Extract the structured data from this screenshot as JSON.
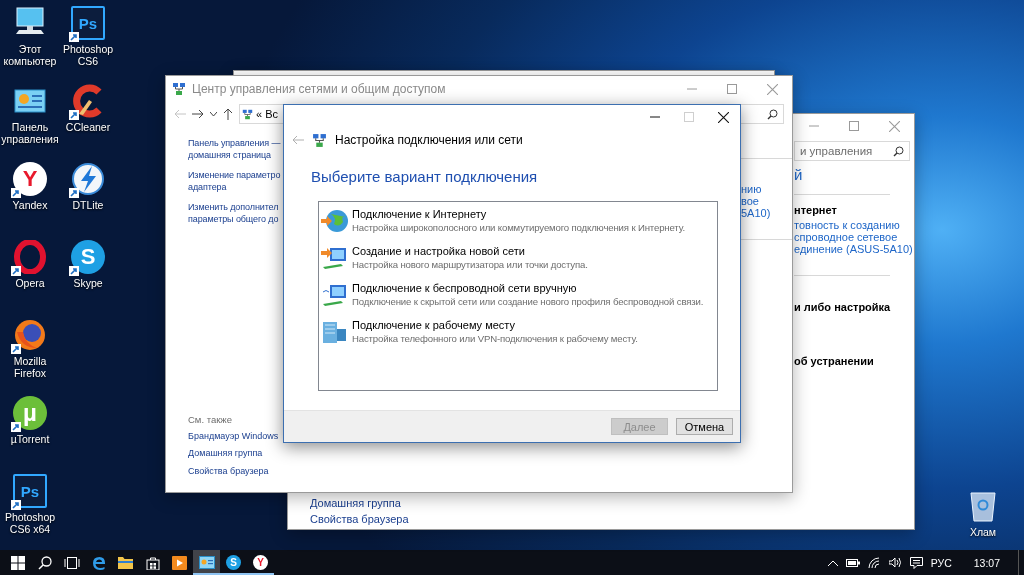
{
  "desktop_icons": [
    {
      "label": "Этот компьютер",
      "kind": "computer",
      "shortcut": false
    },
    {
      "label": "Панель управления",
      "kind": "control-panel",
      "shortcut": false
    },
    {
      "label": "Yandex",
      "kind": "yandex",
      "badge": "Y",
      "shortcut": true
    },
    {
      "label": "Opera",
      "kind": "opera",
      "shortcut": true
    },
    {
      "label": "Mozilla Firefox",
      "kind": "firefox",
      "shortcut": true
    },
    {
      "label": "µTorrent",
      "kind": "utorrent",
      "badge": "µ",
      "shortcut": true
    },
    {
      "label": "Photoshop CS6 x64",
      "kind": "photoshop",
      "badge": "Ps",
      "shortcut": true
    },
    {
      "label": "Photoshop CS6",
      "kind": "photoshop",
      "badge": "Ps",
      "shortcut": true
    },
    {
      "label": "CCleaner",
      "kind": "ccleaner",
      "shortcut": true
    },
    {
      "label": "DTLite",
      "kind": "dtlite",
      "shortcut": true
    },
    {
      "label": "Skype",
      "kind": "skype",
      "badge": "S",
      "shortcut": true
    }
  ],
  "recycle_bin": {
    "label": "Хлам"
  },
  "control_panel_window": {
    "search": {
      "placeholder": "и управления"
    },
    "sections": [
      {
        "divided": true,
        "items": [
          {
            "kind": "heading",
            "text": "й"
          }
        ]
      },
      {
        "divided": true,
        "items": [
          {
            "kind": "label",
            "text": "нтернет"
          },
          {
            "kind": "link",
            "text": "товность к созданию"
          },
          {
            "kind": "link",
            "text": "спроводное сетевое"
          },
          {
            "kind": "link",
            "text": "единение (ASUS-5A10)"
          }
        ]
      },
      {
        "divided": false,
        "items": [
          {
            "kind": "label",
            "text": "и либо настройка"
          }
        ]
      },
      {
        "divided": false,
        "items": [
          {
            "kind": "label",
            "text": "об устранении"
          }
        ]
      }
    ],
    "bottom_links": [
      "Домашняя группа",
      "Свойства браузера"
    ]
  },
  "network_center_window": {
    "title": "Центр управления сетями и общим доступом",
    "address": {
      "chevron": "«",
      "text": "Вс"
    },
    "sidebar_links": [
      {
        "lines": [
          "Панель управления —",
          "домашняя страница"
        ]
      },
      {
        "lines": [
          "Изменение параметро",
          "адаптера"
        ]
      },
      {
        "lines": [
          "Изменить дополнител",
          "параметры общего до"
        ]
      }
    ],
    "see_also": {
      "heading": "См. также",
      "links": [
        "Брандмауэр Windows",
        "Домашняя группа",
        "Свойства браузера"
      ]
    },
    "link_fragments": [
      "нию",
      "вое",
      "5A10)"
    ]
  },
  "dialog": {
    "title": "Настройка подключения или сети",
    "maximize_disabled": true,
    "heading": "Выберите вариант подключения",
    "options": [
      {
        "kind": "internet",
        "title": "Подключение к Интернету",
        "description": "Настройка широкополосного или коммутируемого подключения к Интернету."
      },
      {
        "kind": "network",
        "title": "Создание и настройка новой сети",
        "description": "Настройка нового маршрутизатора или точки доступа."
      },
      {
        "kind": "wireless",
        "title": "Подключение к беспроводной сети вручную",
        "description": "Подключение к скрытой сети или создание нового профиля беспроводной связи."
      },
      {
        "kind": "workplace",
        "title": "Подключение к рабочему месту",
        "description": "Настройка телефонного или VPN-подключения к рабочему месту."
      }
    ],
    "buttons": [
      {
        "label": "Далее",
        "disabled": true
      },
      {
        "label": "Отмена",
        "disabled": false
      }
    ]
  },
  "taskbar": {
    "items": [
      {
        "kind": "start",
        "active": false,
        "running": false
      },
      {
        "kind": "search",
        "active": false,
        "running": false
      },
      {
        "kind": "task-view",
        "active": false,
        "running": false
      },
      {
        "kind": "edge",
        "active": false,
        "running": false
      },
      {
        "kind": "explorer",
        "active": false,
        "running": false
      },
      {
        "kind": "store",
        "active": false,
        "running": false
      },
      {
        "kind": "media",
        "active": false,
        "running": false
      },
      {
        "kind": "control-panel",
        "active": true,
        "running": true
      },
      {
        "kind": "skype",
        "badge": "S",
        "active": false,
        "running": true
      },
      {
        "kind": "yandex",
        "badge": "Y",
        "active": false,
        "running": true
      }
    ],
    "language": "РУС",
    "clock": "13:07"
  }
}
